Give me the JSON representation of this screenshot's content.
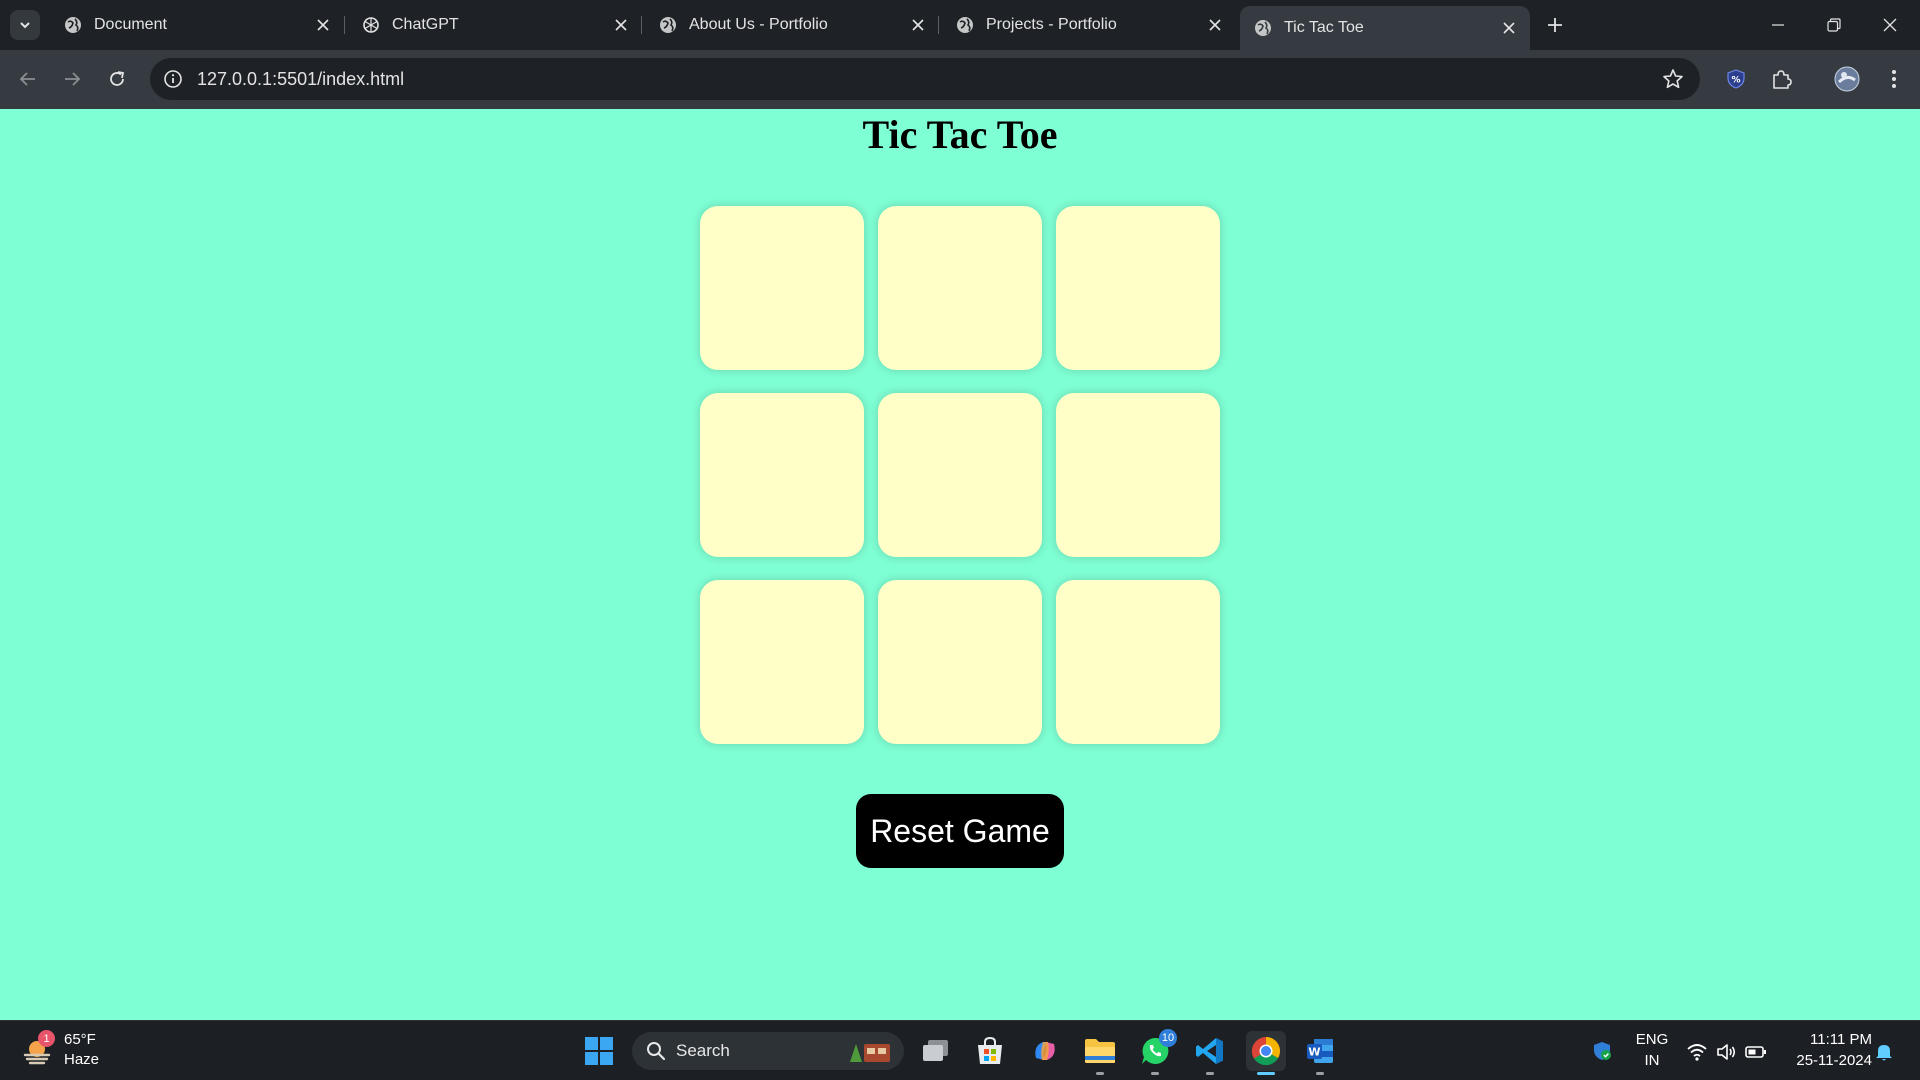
{
  "browser": {
    "tabs": [
      {
        "title": "Document",
        "active": false
      },
      {
        "title": "ChatGPT",
        "active": false
      },
      {
        "title": "About Us - Portfolio",
        "active": false
      },
      {
        "title": "Projects - Portfolio",
        "active": false
      },
      {
        "title": "Tic Tac Toe",
        "active": true
      }
    ],
    "url": "127.0.0.1:5501/index.html"
  },
  "page": {
    "title": "Tic Tac Toe",
    "board": [
      "",
      "",
      "",
      "",
      "",
      "",
      "",
      "",
      ""
    ],
    "reset_label": "Reset Game",
    "colors": {
      "background": "#7fffd4",
      "cell": "#ffffc7",
      "button": "#000000"
    }
  },
  "taskbar": {
    "weather": {
      "temp": "65°F",
      "condition": "Haze",
      "badge": "1"
    },
    "search_label": "Search",
    "whatsapp_badge": "10",
    "language": {
      "line1": "ENG",
      "line2": "IN"
    },
    "time": "11:11 PM",
    "date": "25-11-2024"
  }
}
